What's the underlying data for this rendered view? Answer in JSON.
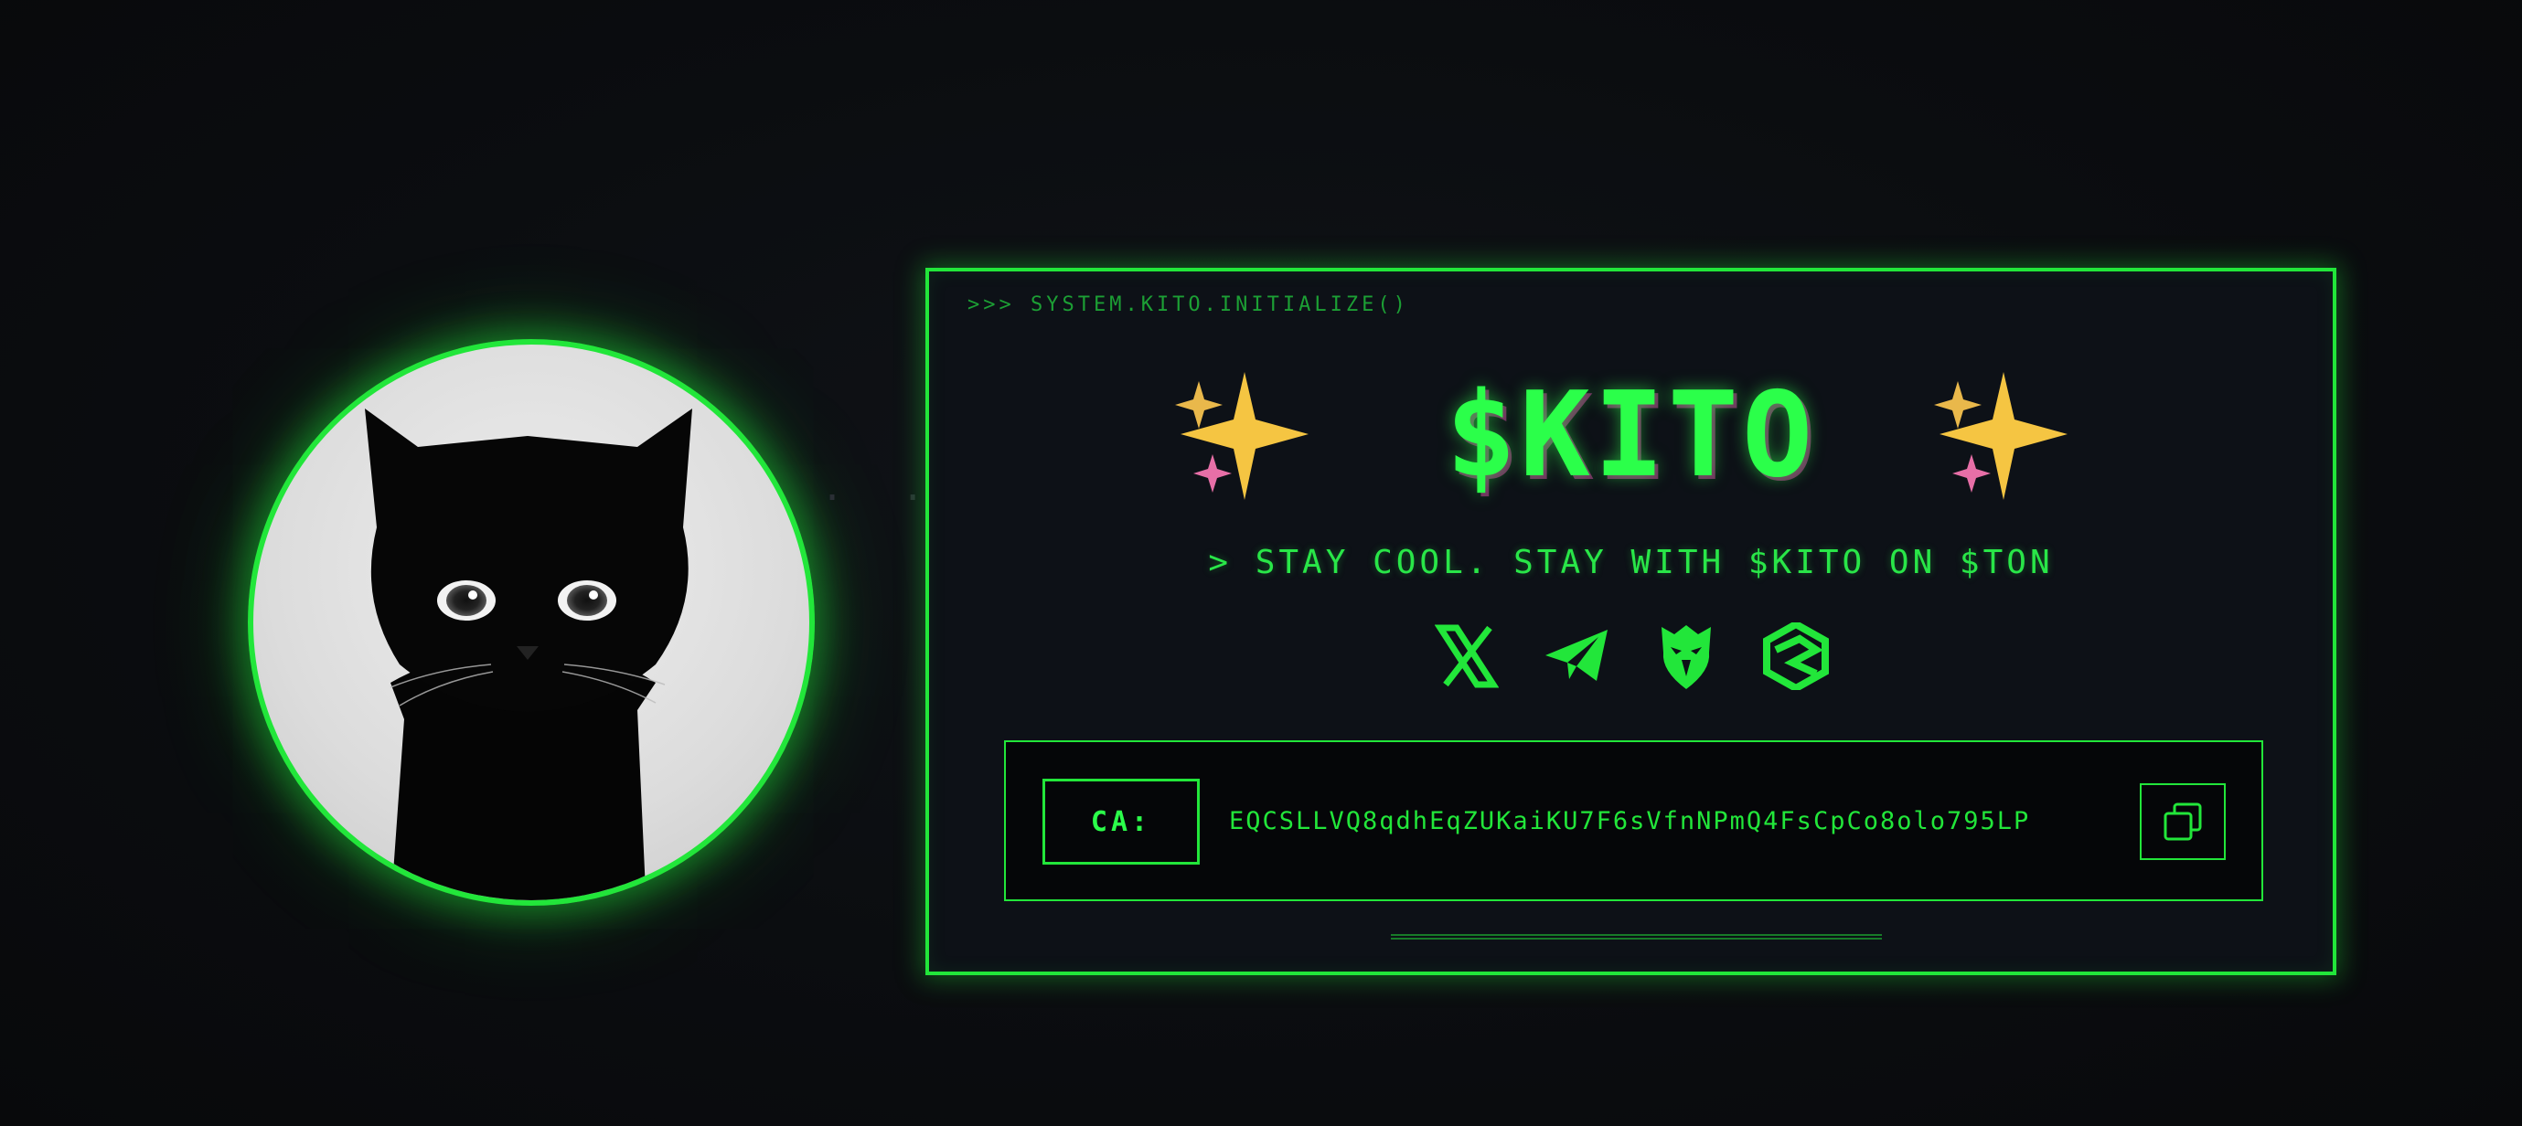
{
  "prompt": ">>> SYSTEM.KITO.INITIALIZE()",
  "title": "$KITO",
  "tagline": "> STAY COOL. STAY WITH $KITO ON $TON",
  "socials": [
    {
      "icon": "x-icon"
    },
    {
      "icon": "telegram-icon"
    },
    {
      "icon": "eagle-icon"
    },
    {
      "icon": "hexagon-logo-icon"
    }
  ],
  "contract": {
    "label": "CA:",
    "address": "EQCSLLVQ8qdhEqZUKaiKU7F6sVfnNPmQ4FsCpCo8olo795LP"
  },
  "avatar": {
    "subject": "black cat"
  },
  "decor_dots": "· ·",
  "colors": {
    "accent": "#22e63a",
    "background": "#0b0d10",
    "panel": "#0d1117",
    "sparkle": "#f5c542",
    "sparkle_pink": "#e76fa7"
  }
}
